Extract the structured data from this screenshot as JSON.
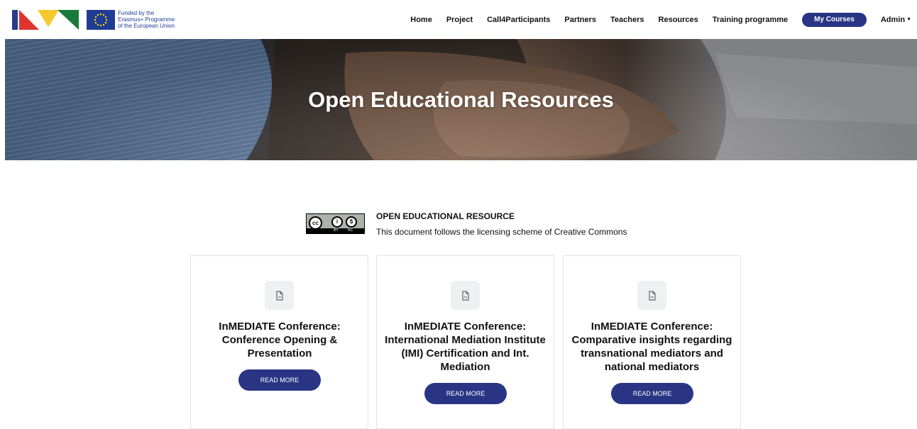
{
  "header": {
    "eu_text": [
      "Funded by the",
      "Erasmus+ Programme",
      "of the European Union"
    ],
    "nav": [
      "Home",
      "Project",
      "Call4Participants",
      "Partners",
      "Teachers",
      "Resources",
      "Training programme"
    ],
    "my_courses": "My Courses",
    "admin": "Admin"
  },
  "hero": {
    "title": "Open Educational Resources"
  },
  "license": {
    "title": "OPEN EDUCATIONAL RESOURCE",
    "description": "This document follows the licensing scheme of Creative Commons",
    "badge_tags": [
      "BY",
      "NC"
    ]
  },
  "cards": [
    {
      "title": "InMEDIATE Conference: Conference Opening & Presentation",
      "button": "READ MORE"
    },
    {
      "title": "InMEDIATE Conference: International Mediation Institute (IMI) Certification and Int. Mediation",
      "button": "READ MORE"
    },
    {
      "title": "InMEDIATE Conference: Comparative insights regarding transnational mediators and national mediators",
      "button": "READ MORE"
    }
  ],
  "colors": {
    "accent": "#293584",
    "eu_blue": "#1f3c95"
  }
}
